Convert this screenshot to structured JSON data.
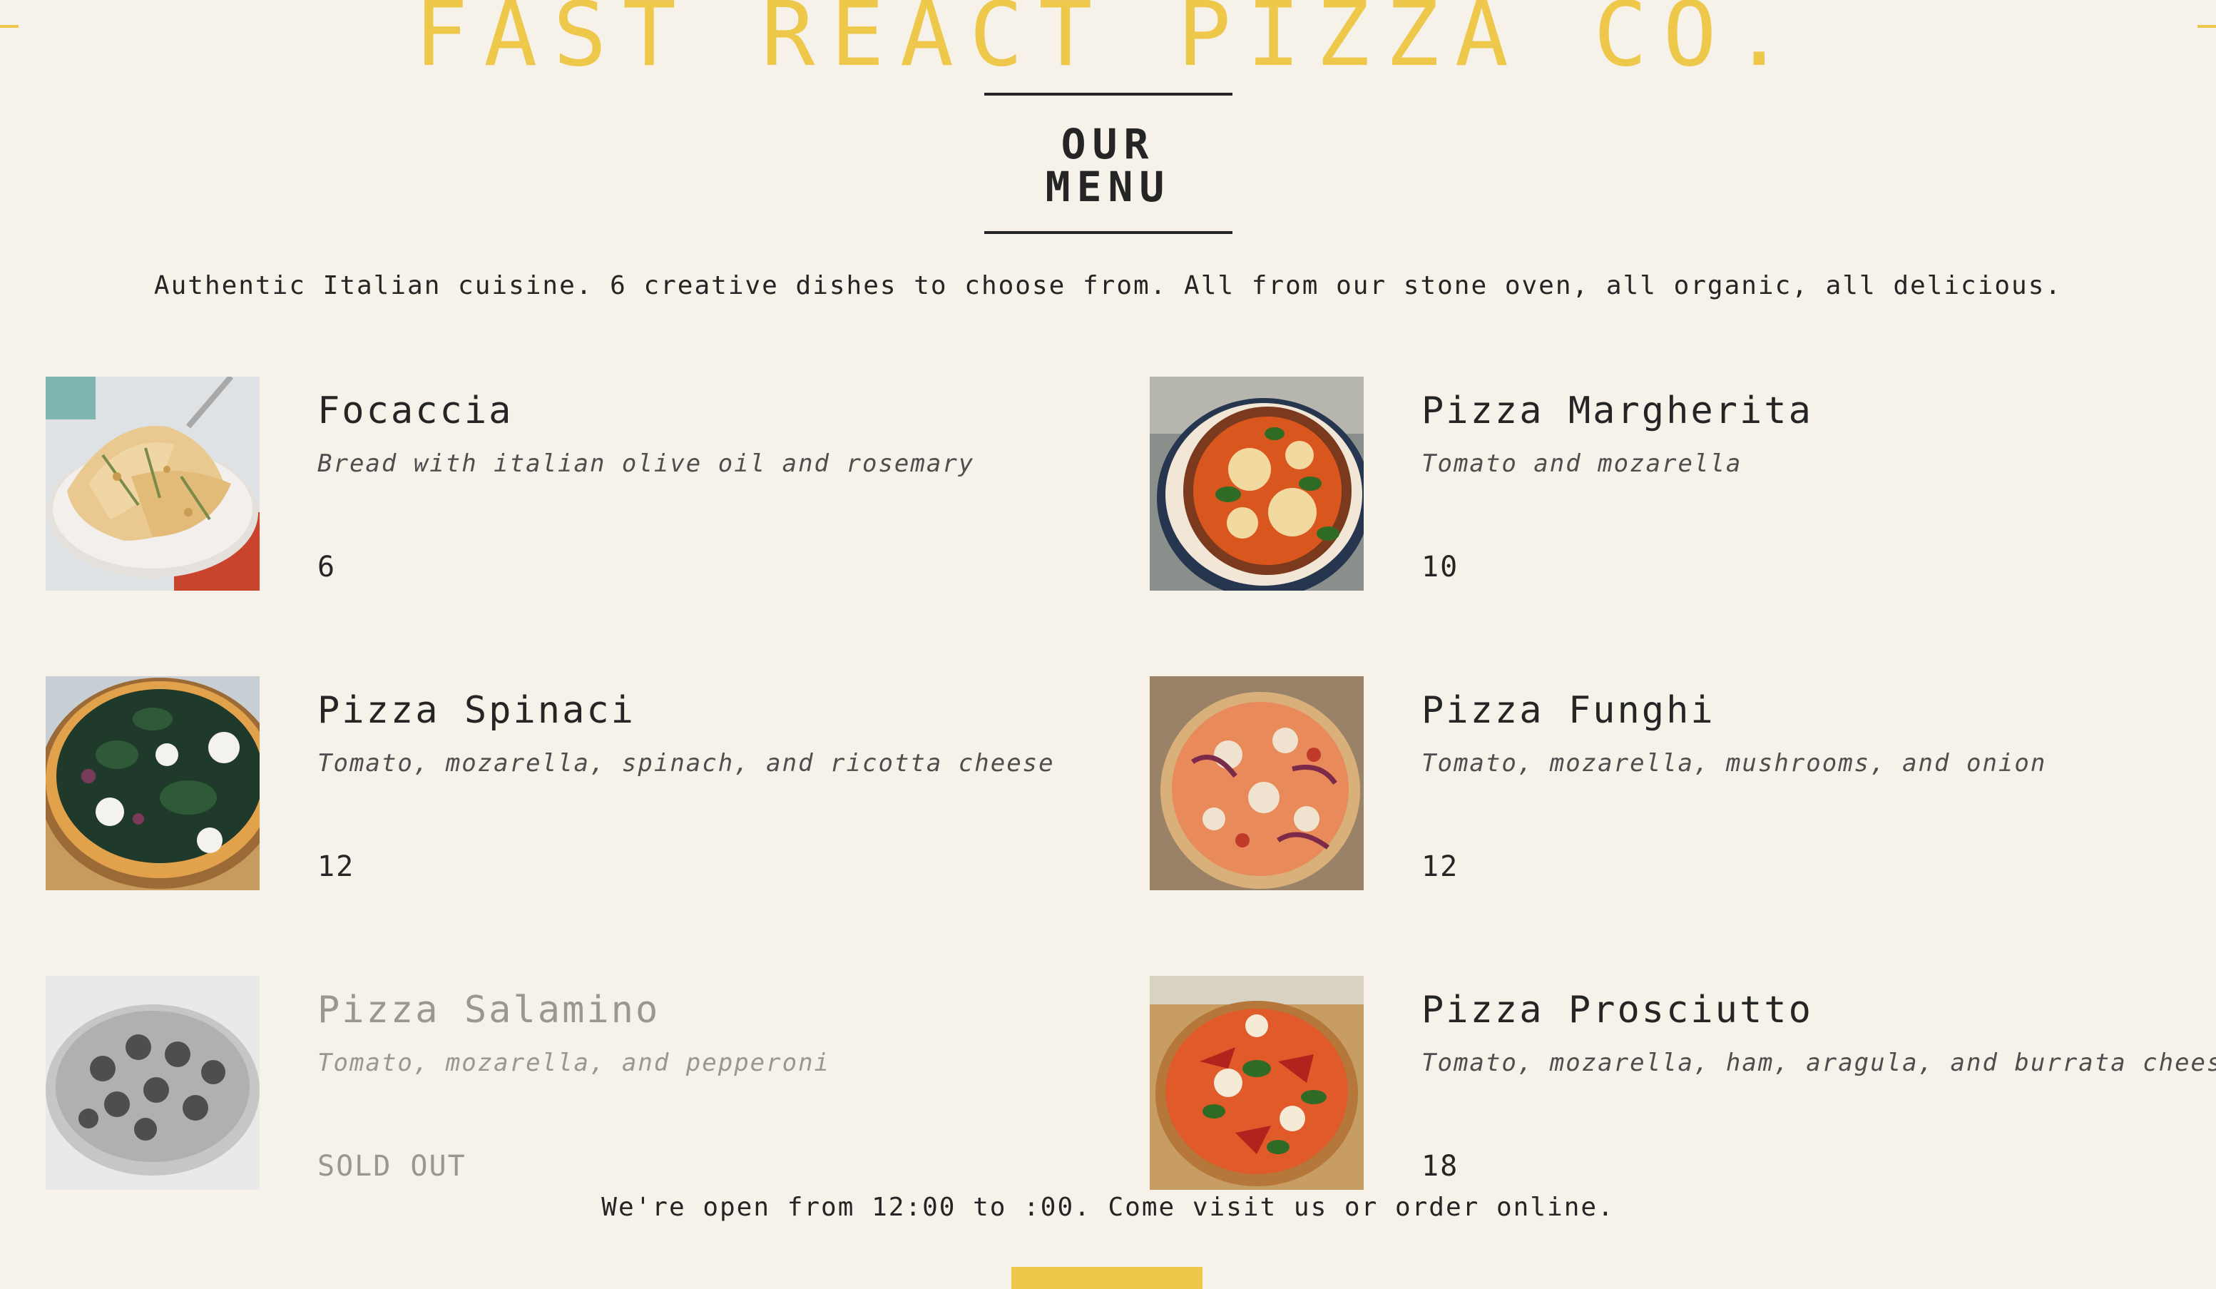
{
  "header": {
    "logo": "FAST REACT PIZZA CO."
  },
  "menu": {
    "title": "OUR MENU",
    "tagline": "Authentic Italian cuisine. 6 creative dishes to choose from. All from our stone oven, all organic, all delicious."
  },
  "pizzas": [
    {
      "name": "Focaccia",
      "ingredients": "Bread with italian olive oil and rosemary",
      "price": "6",
      "sold_out": false,
      "photo": "focaccia-photo"
    },
    {
      "name": "Pizza Margherita",
      "ingredients": "Tomato and mozarella",
      "price": "10",
      "sold_out": false,
      "photo": "margherita-photo"
    },
    {
      "name": "Pizza Spinaci",
      "ingredients": "Tomato, mozarella, spinach, and ricotta cheese",
      "price": "12",
      "sold_out": false,
      "photo": "spinaci-photo"
    },
    {
      "name": "Pizza Funghi",
      "ingredients": "Tomato, mozarella, mushrooms, and onion",
      "price": "12",
      "sold_out": false,
      "photo": "funghi-photo"
    },
    {
      "name": "Pizza Salamino",
      "ingredients": "Tomato, mozarella, and pepperoni",
      "price": "SOLD OUT",
      "sold_out": true,
      "photo": "salamino-photo"
    },
    {
      "name": "Pizza Prosciutto",
      "ingredients": "Tomato, mozarella, ham, aragula, and burrata cheese",
      "price": "18",
      "sold_out": false,
      "photo": "prosciutto-photo"
    }
  ],
  "footer": {
    "text": "We're open from 12:00 to :00. Come visit us or order online."
  },
  "colors": {
    "background": "#f6f2e9",
    "accent": "#edc84b",
    "text": "#252525",
    "muted": "#9a9690"
  }
}
